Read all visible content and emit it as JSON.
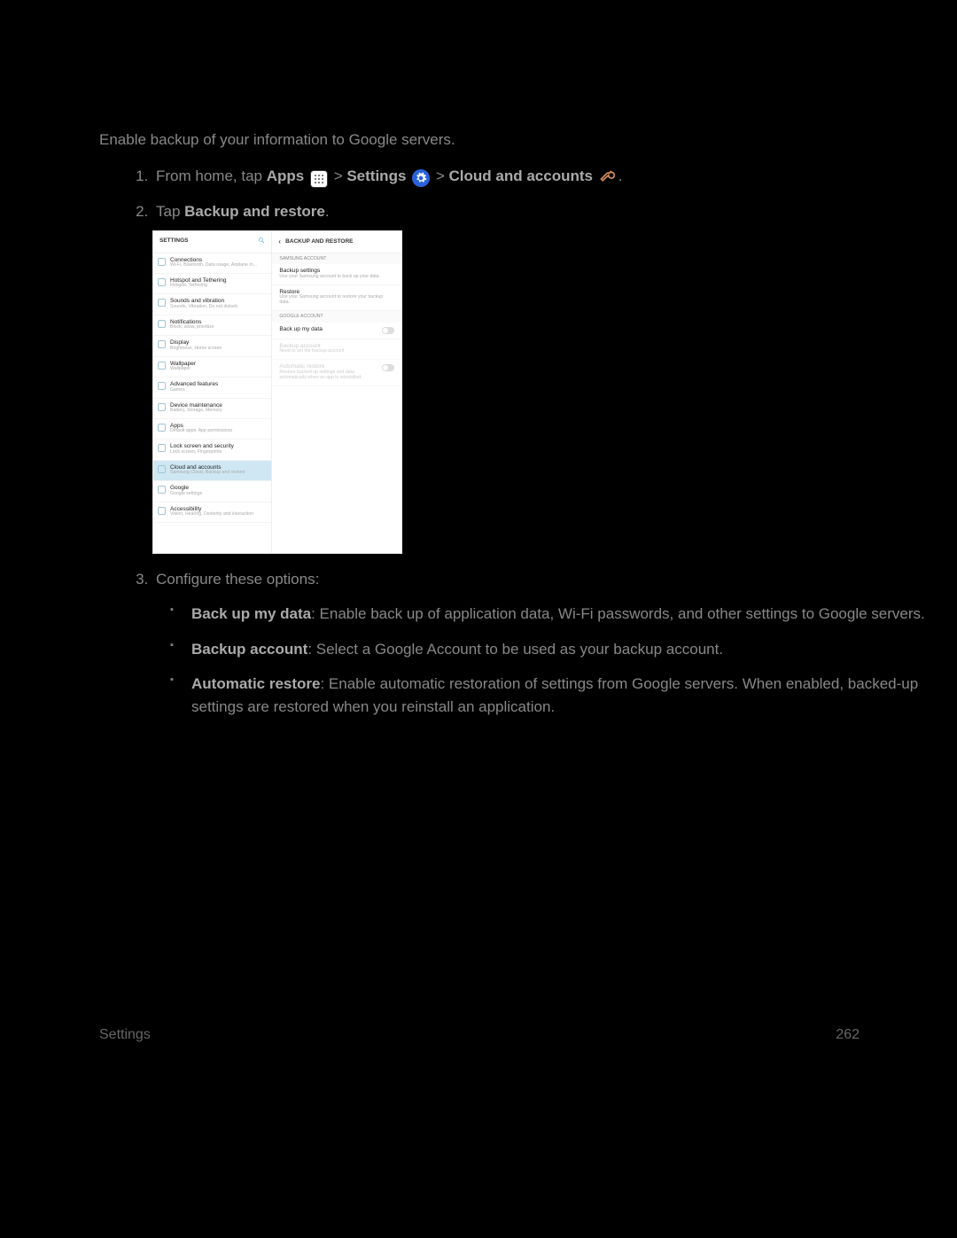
{
  "intro": "Enable backup of your information to Google servers.",
  "step1": {
    "prefix": "From home, tap ",
    "apps": "Apps",
    "sep1": " > ",
    "settings": "Settings",
    "sep2": " > ",
    "cloud": "Cloud and accounts",
    "end": "."
  },
  "step2": {
    "prefix": "Tap ",
    "bold": "Backup and restore",
    "end": "."
  },
  "step3": "Configure these options:",
  "bullets": {
    "b1": {
      "bold": "Back up my data",
      "text": ": Enable back up of application data, Wi-Fi passwords, and other settings to Google servers."
    },
    "b2": {
      "bold": "Backup account",
      "text": ": Select a Google Account to be used as your backup account."
    },
    "b3": {
      "bold": "Automatic restore",
      "text": ": Enable automatic restoration of settings from Google servers. When enabled, backed-up settings are restored when you reinstall an application."
    }
  },
  "footer": {
    "section": "Settings",
    "page": "262"
  },
  "shot": {
    "left_header": "SETTINGS",
    "right_header": "BACKUP AND RESTORE",
    "left_items": [
      {
        "t": "Connections",
        "s": "Wi-Fi, Bluetooth, Data usage, Airplane m..."
      },
      {
        "t": "Hotspot and Tethering",
        "s": "Hotspot, Tethering"
      },
      {
        "t": "Sounds and vibration",
        "s": "Sounds, Vibration, Do not disturb"
      },
      {
        "t": "Notifications",
        "s": "Block, allow, prioritize"
      },
      {
        "t": "Display",
        "s": "Brightness, Home screen"
      },
      {
        "t": "Wallpaper",
        "s": "Wallpaper"
      },
      {
        "t": "Advanced features",
        "s": "Games"
      },
      {
        "t": "Device maintenance",
        "s": "Battery, Storage, Memory"
      },
      {
        "t": "Apps",
        "s": "Default apps, App permissions"
      },
      {
        "t": "Lock screen and security",
        "s": "Lock screen, Fingerprints"
      },
      {
        "t": "Cloud and accounts",
        "s": "Samsung Cloud, Backup and restore",
        "active": true
      },
      {
        "t": "Google",
        "s": "Google settings"
      },
      {
        "t": "Accessibility",
        "s": "Vision, Hearing, Dexterity and interaction"
      }
    ],
    "sect1": "SAMSUNG ACCOUNT",
    "r1": {
      "t": "Backup settings",
      "s": "Use your Samsung account to back up your data."
    },
    "r2": {
      "t": "Restore",
      "s": "Use your Samsung account to restore your backup data."
    },
    "sect2": "GOOGLE ACCOUNT",
    "r3": {
      "t": "Back up my data",
      "s": ""
    },
    "r4": {
      "t": "Backup account",
      "s": "Need to set the backup account"
    },
    "r5": {
      "t": "Automatic restore",
      "s": "Restore backed up settings and data automatically when an app is reinstalled."
    }
  }
}
